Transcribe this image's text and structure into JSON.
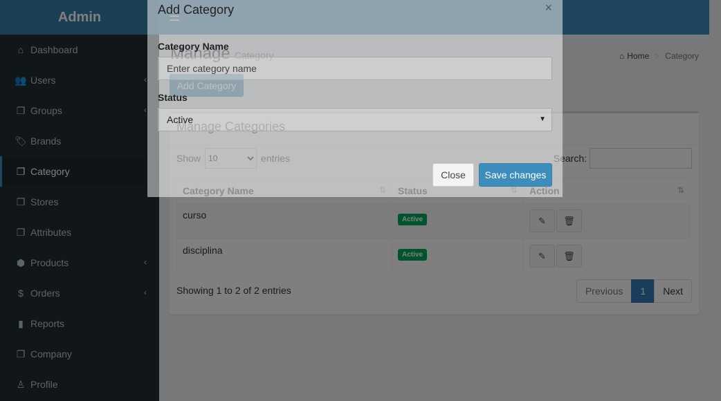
{
  "header": {
    "logo": "Admin",
    "toggle_icon": "☰"
  },
  "sidebar": {
    "items": [
      {
        "label": "Dashboard",
        "icon": "dashboard-icon",
        "glyph": "⌂",
        "chevron": false,
        "active": false
      },
      {
        "label": "Users",
        "icon": "users-icon",
        "glyph": "👥",
        "chevron": true,
        "active": false
      },
      {
        "label": "Groups",
        "icon": "files-icon",
        "glyph": "❐",
        "chevron": true,
        "active": false
      },
      {
        "label": "Brands",
        "icon": "tags-icon",
        "glyph": "🏷",
        "chevron": false,
        "active": false
      },
      {
        "label": "Category",
        "icon": "files-icon",
        "glyph": "❐",
        "chevron": false,
        "active": true
      },
      {
        "label": "Stores",
        "icon": "files-icon",
        "glyph": "❐",
        "chevron": false,
        "active": false
      },
      {
        "label": "Attributes",
        "icon": "files-icon",
        "glyph": "❐",
        "chevron": false,
        "active": false
      },
      {
        "label": "Products",
        "icon": "cube-icon",
        "glyph": "⬢",
        "chevron": true,
        "active": false
      },
      {
        "label": "Orders",
        "icon": "dollar-icon",
        "glyph": "$",
        "chevron": true,
        "active": false
      },
      {
        "label": "Reports",
        "icon": "bar-chart-icon",
        "glyph": "▮",
        "chevron": false,
        "active": false
      },
      {
        "label": "Company",
        "icon": "files-icon",
        "glyph": "❐",
        "chevron": false,
        "active": false
      },
      {
        "label": "Profile",
        "icon": "user-icon",
        "glyph": "♙",
        "chevron": false,
        "active": false
      }
    ]
  },
  "content": {
    "title": "Manage",
    "subtitle": "Category",
    "breadcrumb": {
      "home": "Home",
      "current": "Category"
    },
    "add_button": "Add Category",
    "box": {
      "title": "Manage Categories",
      "show_label": "Show",
      "entries_value": "10",
      "entries_label": "entries",
      "search_label": "Search:",
      "columns": [
        "Category Name",
        "Status",
        "Action"
      ],
      "rows": [
        {
          "name": "curso",
          "status": "Active"
        },
        {
          "name": "disciplina",
          "status": "Active"
        }
      ],
      "info": "Showing 1 to 2 of 2 entries",
      "pagination": {
        "prev": "Previous",
        "page": "1",
        "next": "Next"
      }
    }
  },
  "modal": {
    "title": "Add Category",
    "close_glyph": "×",
    "name_label": "Category Name",
    "name_placeholder": "Enter category name",
    "status_label": "Status",
    "status_value": "Active",
    "close_button": "Close",
    "save_button": "Save changes"
  },
  "colors": {
    "header": "#3c8dbc",
    "sidebar": "#222d32",
    "badge": "#00a65a"
  }
}
